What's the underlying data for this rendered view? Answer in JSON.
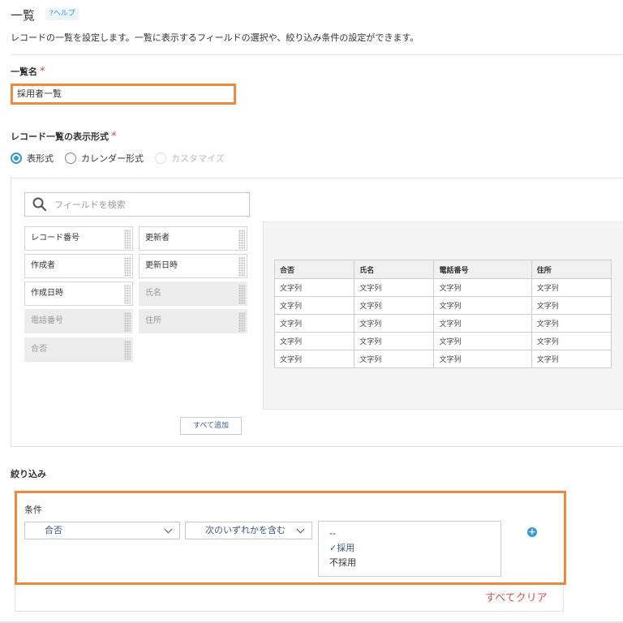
{
  "header": {
    "title": "一覧",
    "help": "?ヘルプ",
    "description": "レコードの一覧を設定します。一覧に表示するフィールドの選択や、絞り込み条件の設定ができます。"
  },
  "name_field": {
    "label": "一覧名",
    "required_mark": "*",
    "value": "採用者一覧"
  },
  "display_format": {
    "label": "レコード一覧の表示形式",
    "required_mark": "*",
    "options": [
      {
        "label": "表形式",
        "state": "selected"
      },
      {
        "label": "カレンダー形式",
        "state": "unselected"
      },
      {
        "label": "カスタマイズ",
        "state": "disabled"
      }
    ]
  },
  "field_picker": {
    "search_placeholder": "フィールドを検索",
    "fields": [
      {
        "label": "レコード番号",
        "disabled": false
      },
      {
        "label": "更新者",
        "disabled": false
      },
      {
        "label": "作成者",
        "disabled": false
      },
      {
        "label": "更新日時",
        "disabled": false
      },
      {
        "label": "作成日時",
        "disabled": false
      },
      {
        "label": "氏名",
        "disabled": true
      },
      {
        "label": "電話番号",
        "disabled": true
      },
      {
        "label": "住所",
        "disabled": true
      },
      {
        "label": "合否",
        "disabled": true
      }
    ],
    "add_all_label": "すべて追加"
  },
  "preview_table": {
    "columns": [
      "合否",
      "氏名",
      "電話番号",
      "住所"
    ],
    "rows": [
      [
        "文字列",
        "文字列",
        "文字列",
        "文字列"
      ],
      [
        "文字列",
        "文字列",
        "文字列",
        "文字列"
      ],
      [
        "文字列",
        "文字列",
        "文字列",
        "文字列"
      ],
      [
        "文字列",
        "文字列",
        "文字列",
        "文字列"
      ],
      [
        "文字列",
        "文字列",
        "文字列",
        "文字列"
      ]
    ]
  },
  "filter": {
    "title": "絞り込み",
    "condition_label": "条件",
    "field_select": "合否",
    "operator_select": "次のいずれかを含む",
    "options": [
      {
        "label": "--",
        "checked": false
      },
      {
        "label": "採用",
        "checked": true
      },
      {
        "label": "不採用",
        "checked": false
      }
    ],
    "clear_all_label": "すべてクリア"
  },
  "colors": {
    "accent": "#3498db",
    "highlight": "#f0883a",
    "danger": "#d9534f"
  }
}
